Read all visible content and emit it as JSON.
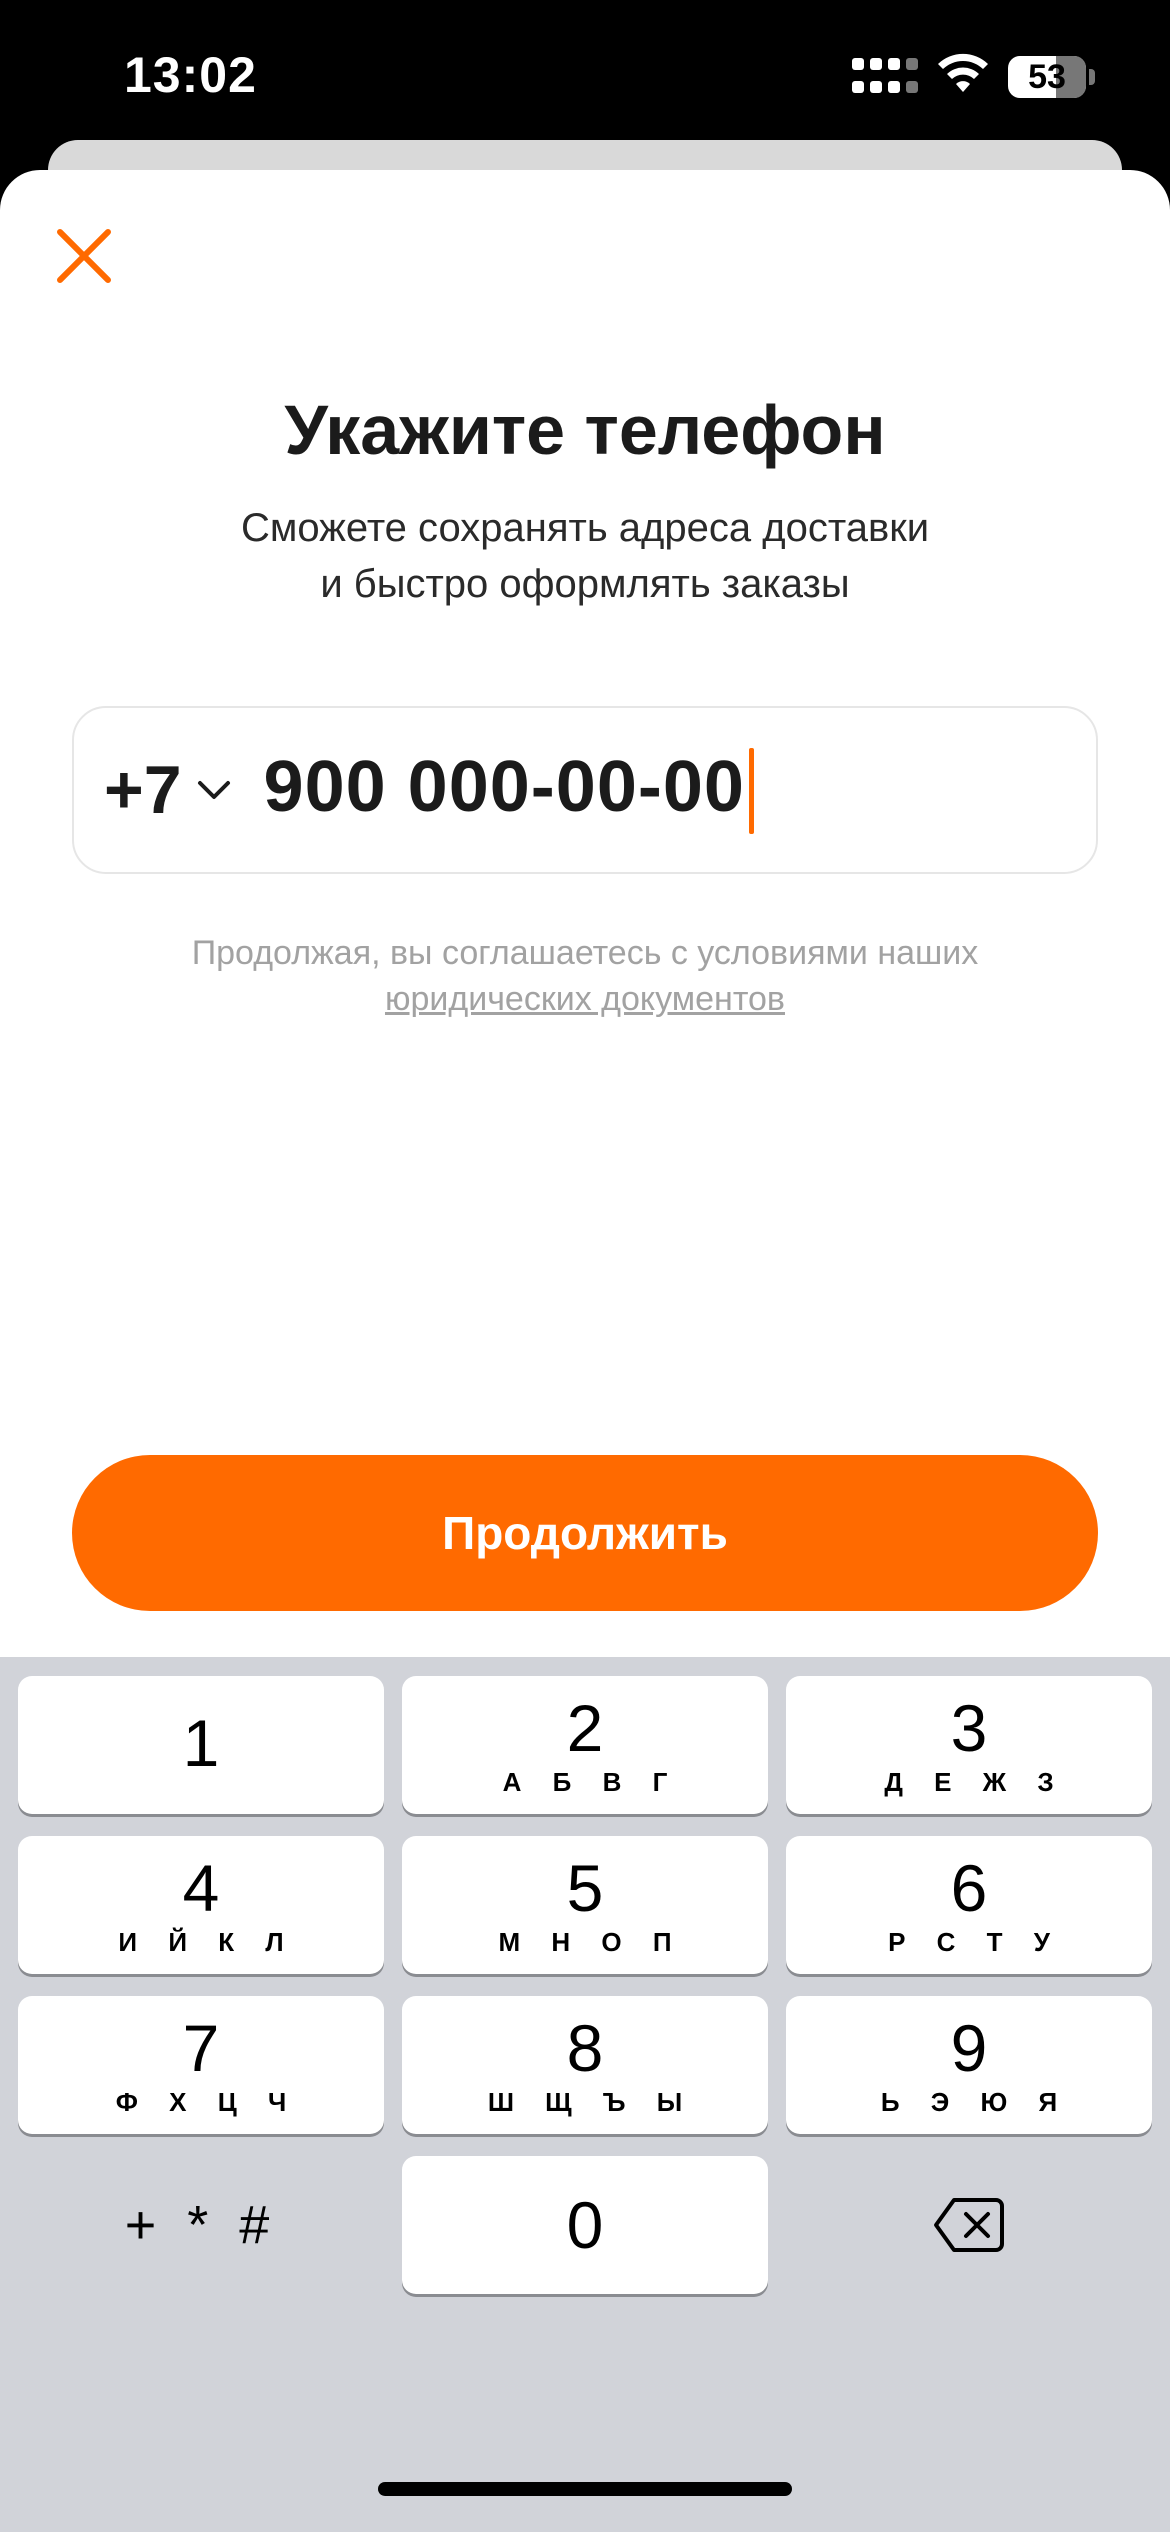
{
  "status_bar": {
    "time": "13:02",
    "battery": "53"
  },
  "header": {
    "title": "Укажите телефон",
    "subtitle_line1": "Сможете сохранять адреса доставки",
    "subtitle_line2": "и быстро оформлять заказы"
  },
  "phone": {
    "country_code": "+7",
    "number": "900 000-00-00"
  },
  "legal": {
    "text": "Продолжая, вы соглашаетесь с условиями наших",
    "link": "юридических документов"
  },
  "continue_label": "Продолжить",
  "accent_color": "#ff6a00",
  "keyboard": {
    "keys": [
      {
        "digit": "1",
        "letters": ""
      },
      {
        "digit": "2",
        "letters": "А Б В Г"
      },
      {
        "digit": "3",
        "letters": "Д Е Ж З"
      },
      {
        "digit": "4",
        "letters": "И Й К Л"
      },
      {
        "digit": "5",
        "letters": "М Н О П"
      },
      {
        "digit": "6",
        "letters": "Р С Т У"
      },
      {
        "digit": "7",
        "letters": "Ф Х Ц Ч"
      },
      {
        "digit": "8",
        "letters": "Ш Щ Ъ Ы"
      },
      {
        "digit": "9",
        "letters": "Ь Э Ю Я"
      },
      {
        "digit": "0",
        "letters": ""
      }
    ],
    "symbols_key": "+ * #",
    "delete_icon": "backspace-icon"
  }
}
